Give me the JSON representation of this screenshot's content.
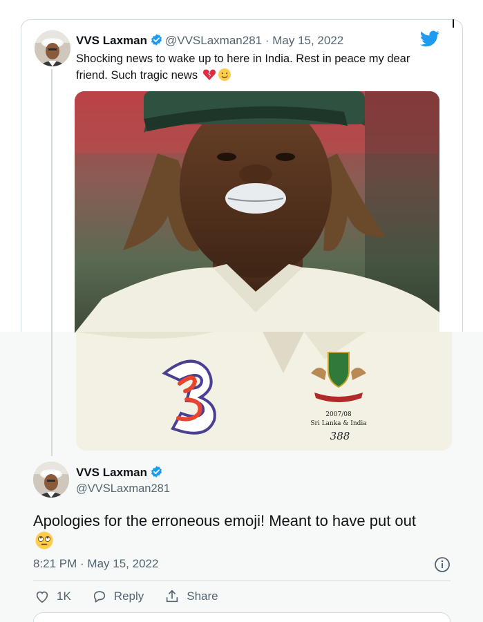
{
  "tweet": {
    "author_name": "VVS Laxman",
    "handle": "@VVSLaxman281",
    "separator": " · ",
    "date": "May 15, 2022",
    "text": "Shocking news to wake up to here in India. Rest in peace my dear friend. Such tragic news",
    "emojis": [
      "broken-heart-emoji",
      "smiling-with-tear-emoji"
    ],
    "has_verified_badge": true,
    "brand_color": "#1d9bf0"
  },
  "reply": {
    "author_name": "VVS Laxman",
    "handle": "@VVSLaxman281",
    "text": "Apologies for the erroneous emoji! Meant to have put out",
    "emoji": "face-with-rolling-eyes-emoji",
    "timestamp": "8:21 PM · May 15, 2022",
    "like_count": "1K",
    "reply_label": "Reply",
    "share_label": "Share"
  },
  "photo": {
    "description_icon": "cricket-player-photo",
    "shirt_logo_text": "3",
    "badge_line1": "2007/08",
    "badge_line2": "Sri Lanka & India",
    "badge_number": "388"
  }
}
